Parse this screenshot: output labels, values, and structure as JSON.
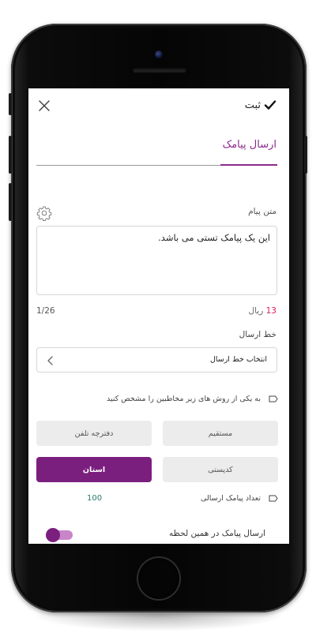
{
  "topbar": {
    "submit_label": "ثبت"
  },
  "tab": {
    "title": "ارسال پیامک"
  },
  "message": {
    "label": "متن پیام",
    "text": "این یک پیامک تستی می باشد.",
    "price_value": "13",
    "price_unit": "ریال",
    "counter": "1/26"
  },
  "send_line": {
    "label": "خط ارسال",
    "placeholder": "انتخاب خط ارسال"
  },
  "recipients": {
    "instruction": "به یکی از روش های زیر مخاطبین را مشخص کنید",
    "options": [
      {
        "label": "مستقیم"
      },
      {
        "label": "دفترچه تلفن"
      },
      {
        "label": "کدپستی"
      },
      {
        "label": "استان"
      }
    ],
    "selected": "استان"
  },
  "count": {
    "label": "تعداد پیامک ارسالی",
    "value": "100"
  },
  "send_now": {
    "label": "ارسال پیامک در همین لحظه",
    "enabled": true
  },
  "colors": {
    "accent": "#7b1f7f",
    "tab_accent": "#8a2b8e",
    "price_red": "#d81b60",
    "count_teal": "#2a7a6a"
  },
  "icons": [
    "check-icon",
    "close-icon",
    "gear-icon",
    "chevron-left-icon",
    "hand-pointer-icon"
  ]
}
